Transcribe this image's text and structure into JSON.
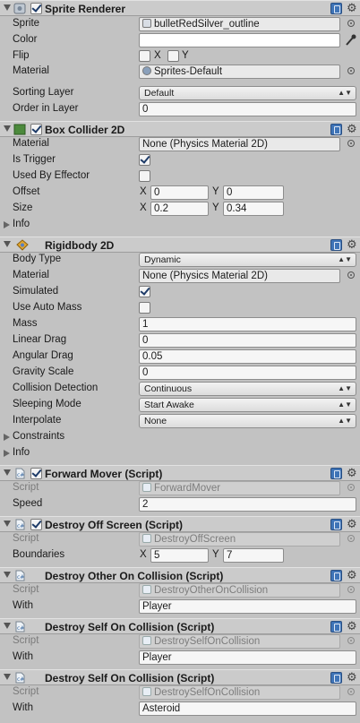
{
  "sprite_renderer": {
    "title": "Sprite Renderer",
    "sprite_label": "Sprite",
    "sprite_value": "bulletRedSilver_outline",
    "color_label": "Color",
    "flip_label": "Flip",
    "flip_x": "X",
    "flip_y": "Y",
    "material_label": "Material",
    "material_value": "Sprites-Default",
    "sorting_layer_label": "Sorting Layer",
    "sorting_layer_value": "Default",
    "order_label": "Order in Layer",
    "order_value": "0"
  },
  "box_collider": {
    "title": "Box Collider 2D",
    "material_label": "Material",
    "material_value": "None (Physics Material 2D)",
    "trigger_label": "Is Trigger",
    "effector_label": "Used By Effector",
    "offset_label": "Offset",
    "offset_x": "0",
    "offset_y": "0",
    "size_label": "Size",
    "size_x": "0.2",
    "size_y": "0.34",
    "info_label": "Info",
    "x_label": "X",
    "y_label": "Y"
  },
  "rigidbody": {
    "title": "Rigidbody 2D",
    "body_type_label": "Body Type",
    "body_type_value": "Dynamic",
    "material_label": "Material",
    "material_value": "None (Physics Material 2D)",
    "simulated_label": "Simulated",
    "auto_mass_label": "Use Auto Mass",
    "mass_label": "Mass",
    "mass_value": "1",
    "linear_drag_label": "Linear Drag",
    "linear_drag_value": "0",
    "angular_drag_label": "Angular Drag",
    "angular_drag_value": "0.05",
    "gravity_label": "Gravity Scale",
    "gravity_value": "0",
    "collision_label": "Collision Detection",
    "collision_value": "Continuous",
    "sleeping_label": "Sleeping Mode",
    "sleeping_value": "Start Awake",
    "interpolate_label": "Interpolate",
    "interpolate_value": "None",
    "constraints_label": "Constraints",
    "info_label": "Info"
  },
  "forward_mover": {
    "title": "Forward Mover (Script)",
    "script_label": "Script",
    "script_value": "ForwardMover",
    "speed_label": "Speed",
    "speed_value": "2"
  },
  "destroy_off_screen": {
    "title": "Destroy Off Screen (Script)",
    "script_label": "Script",
    "script_value": "DestroyOffScreen",
    "boundaries_label": "Boundaries",
    "bx": "5",
    "by": "7",
    "x_label": "X",
    "y_label": "Y"
  },
  "destroy_other": {
    "title": "Destroy Other On Collision (Script)",
    "script_label": "Script",
    "script_value": "DestroyOtherOnCollision",
    "with_label": "With",
    "with_value": "Player"
  },
  "destroy_self_1": {
    "title": "Destroy Self On Collision (Script)",
    "script_label": "Script",
    "script_value": "DestroySelfOnCollision",
    "with_label": "With",
    "with_value": "Player"
  },
  "destroy_self_2": {
    "title": "Destroy Self On Collision (Script)",
    "script_label": "Script",
    "script_value": "DestroySelfOnCollision",
    "with_label": "With",
    "with_value": "Asteroid"
  },
  "colors": {
    "panel": "#c2c2c2",
    "header": "#cbcbcb",
    "help": "#3f74b7"
  }
}
